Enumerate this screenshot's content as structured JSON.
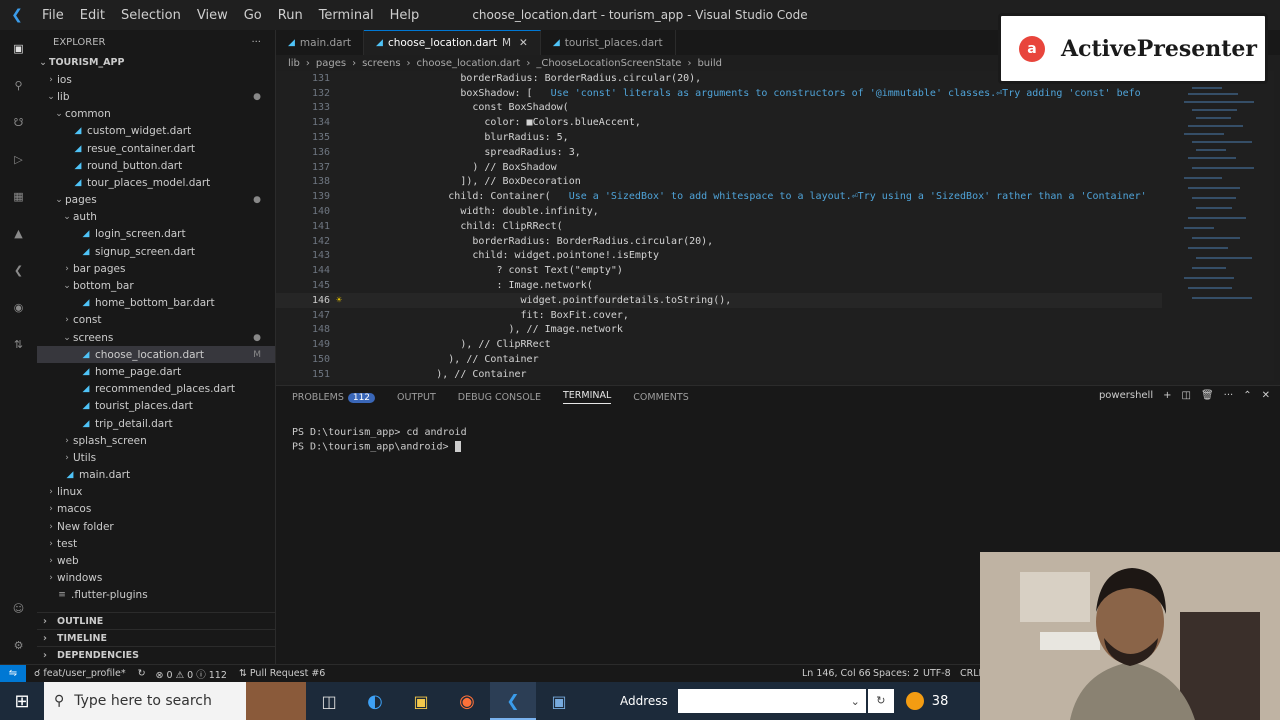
{
  "window": {
    "title": "choose_location.dart - tourism_app - Visual Studio Code",
    "menu": [
      "File",
      "Edit",
      "Selection",
      "View",
      "Go",
      "Run",
      "Terminal",
      "Help"
    ]
  },
  "sidebar": {
    "header": "EXPLORER",
    "root": "TOURISM_APP",
    "tree": [
      {
        "label": "ios",
        "depth": 0,
        "type": "folder",
        "open": false
      },
      {
        "label": "lib",
        "depth": 0,
        "type": "folder",
        "open": true,
        "dot": true
      },
      {
        "label": "common",
        "depth": 1,
        "type": "folder",
        "open": true
      },
      {
        "label": "custom_widget.dart",
        "depth": 2,
        "type": "file"
      },
      {
        "label": "resue_container.dart",
        "depth": 2,
        "type": "file"
      },
      {
        "label": "round_button.dart",
        "depth": 2,
        "type": "file"
      },
      {
        "label": "tour_places_model.dart",
        "depth": 2,
        "type": "file"
      },
      {
        "label": "pages",
        "depth": 1,
        "type": "folder",
        "open": true,
        "dot": true
      },
      {
        "label": "auth",
        "depth": 2,
        "type": "folder",
        "open": true
      },
      {
        "label": "login_screen.dart",
        "depth": 3,
        "type": "file"
      },
      {
        "label": "signup_screen.dart",
        "depth": 3,
        "type": "file"
      },
      {
        "label": "bar pages",
        "depth": 2,
        "type": "folder",
        "open": false
      },
      {
        "label": "bottom_bar",
        "depth": 2,
        "type": "folder",
        "open": true
      },
      {
        "label": "home_bottom_bar.dart",
        "depth": 3,
        "type": "file"
      },
      {
        "label": "const",
        "depth": 2,
        "type": "folder",
        "open": false
      },
      {
        "label": "screens",
        "depth": 2,
        "type": "folder",
        "open": true,
        "dot": true
      },
      {
        "label": "choose_location.dart",
        "depth": 3,
        "type": "file",
        "selected": true,
        "badge": "M"
      },
      {
        "label": "home_page.dart",
        "depth": 3,
        "type": "file"
      },
      {
        "label": "recommended_places.dart",
        "depth": 3,
        "type": "file"
      },
      {
        "label": "tourist_places.dart",
        "depth": 3,
        "type": "file"
      },
      {
        "label": "trip_detail.dart",
        "depth": 3,
        "type": "file"
      },
      {
        "label": "splash_screen",
        "depth": 2,
        "type": "folder",
        "open": false
      },
      {
        "label": "Utils",
        "depth": 2,
        "type": "folder",
        "open": false
      },
      {
        "label": "main.dart",
        "depth": 1,
        "type": "file"
      },
      {
        "label": "linux",
        "depth": 0,
        "type": "folder",
        "open": false
      },
      {
        "label": "macos",
        "depth": 0,
        "type": "folder",
        "open": false
      },
      {
        "label": "New folder",
        "depth": 0,
        "type": "folder",
        "open": false
      },
      {
        "label": "test",
        "depth": 0,
        "type": "folder",
        "open": false
      },
      {
        "label": "web",
        "depth": 0,
        "type": "folder",
        "open": false
      },
      {
        "label": "windows",
        "depth": 0,
        "type": "folder",
        "open": false
      },
      {
        "label": ".flutter-plugins",
        "depth": 0,
        "type": "plain"
      }
    ],
    "sections": [
      "OUTLINE",
      "TIMELINE",
      "DEPENDENCIES"
    ]
  },
  "tabs": [
    {
      "label": "main.dart",
      "active": false
    },
    {
      "label": "choose_location.dart",
      "active": true,
      "modified": "M"
    },
    {
      "label": "tourist_places.dart",
      "active": false
    }
  ],
  "breadcrumb": [
    "lib",
    "pages",
    "screens",
    "choose_location.dart",
    "_ChooseLocationScreenState",
    "build"
  ],
  "code": [
    {
      "n": "131",
      "text": "                borderRadius: BorderRadius.circular(20),"
    },
    {
      "n": "132",
      "text": "                boxShadow: [",
      "lint": "   Use 'const' literals as arguments to constructors of '@immutable' classes.⏎Try adding 'const' befo"
    },
    {
      "n": "133",
      "text": "                  const BoxShadow("
    },
    {
      "n": "134",
      "text": "                    color: ■Colors.blueAccent,"
    },
    {
      "n": "135",
      "text": "                    blurRadius: 5,"
    },
    {
      "n": "136",
      "text": "                    spreadRadius: 3,"
    },
    {
      "n": "137",
      "text": "                  ) // BoxShadow"
    },
    {
      "n": "138",
      "text": "                ]), // BoxDecoration"
    },
    {
      "n": "139",
      "text": "              child: Container(",
      "lint": "   Use a 'SizedBox' to add whitespace to a layout.⏎Try using a 'SizedBox' rather than a 'Container'"
    },
    {
      "n": "140",
      "text": "                width: double.infinity,"
    },
    {
      "n": "141",
      "text": "                child: ClipRRect("
    },
    {
      "n": "142",
      "text": "                  borderRadius: BorderRadius.circular(20),"
    },
    {
      "n": "143",
      "text": "                  child: widget.pointone!.isEmpty"
    },
    {
      "n": "144",
      "text": "                      ? const Text(\"empty\")"
    },
    {
      "n": "145",
      "text": "                      : Image.network("
    },
    {
      "n": "146",
      "text": "                          widget.pointfourdetails.toString(),",
      "current": true
    },
    {
      "n": "147",
      "text": "                          fit: BoxFit.cover,"
    },
    {
      "n": "148",
      "text": "                        ), // Image.network"
    },
    {
      "n": "149",
      "text": "                ), // ClipRRect"
    },
    {
      "n": "150",
      "text": "              ), // Container"
    },
    {
      "n": "151",
      "text": "            ), // Container"
    }
  ],
  "panel": {
    "tabs": [
      "PROBLEMS",
      "OUTPUT",
      "DEBUG CONSOLE",
      "TERMINAL",
      "COMMENTS"
    ],
    "problems_count": "112",
    "active_tab": "TERMINAL",
    "shell": "powershell",
    "terminal_lines": [
      "PS D:\\tourism_app> cd android",
      "PS D:\\tourism_app\\android> "
    ]
  },
  "statusbar": {
    "branch": "feat/user_profile*",
    "errors": "0",
    "warnings": "0",
    "info": "112",
    "pull_request": "Pull Request #6",
    "position": "Ln 146, Col 66",
    "spaces": "Spaces: 2",
    "encoding": "UTF-8",
    "eol": "CRLF"
  },
  "taskbar": {
    "search_placeholder": "Type here to search",
    "address_label": "Address",
    "temperature": "38"
  },
  "overlay": {
    "brand": "ActivePresenter"
  },
  "colors": {
    "accent": "#0078d4",
    "bg": "#1e1e1e",
    "keyword": "#569cd6",
    "lint": "#4fa3d8"
  }
}
